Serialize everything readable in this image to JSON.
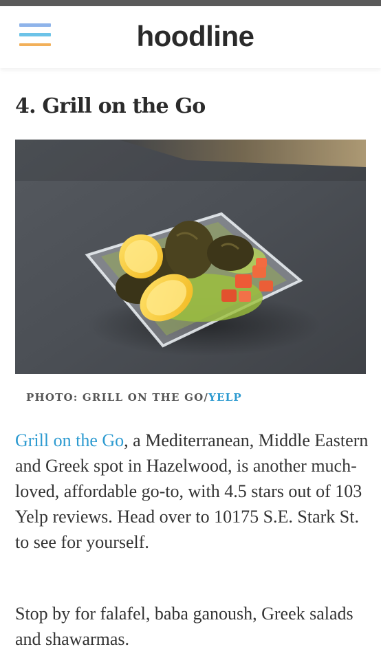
{
  "header": {
    "logo_text": "hoodline",
    "menu_bar_colors": [
      "#8fb4ea",
      "#6cc3e8",
      "#f2b05a"
    ]
  },
  "article": {
    "title": "4. Grill on the Go",
    "photo_credit": {
      "prefix": "PHOTO: GRILL ON THE GO/",
      "link_label": "YELP"
    },
    "paragraph1": {
      "link_text": "Grill on the Go",
      "text": ", a Mediterranean, Middle Eastern and Greek spot in Hazelwood, is another much-loved, affordable go-to, with 4.5 stars out of 103 Yelp reviews. Head over to 10175 S.E. Stark St. to see for yourself."
    },
    "paragraph2": "Stop by for falafel, baba ganoush, Greek salads and shawarmas."
  },
  "colors": {
    "link": "#2c9ad0",
    "text": "#333333"
  }
}
